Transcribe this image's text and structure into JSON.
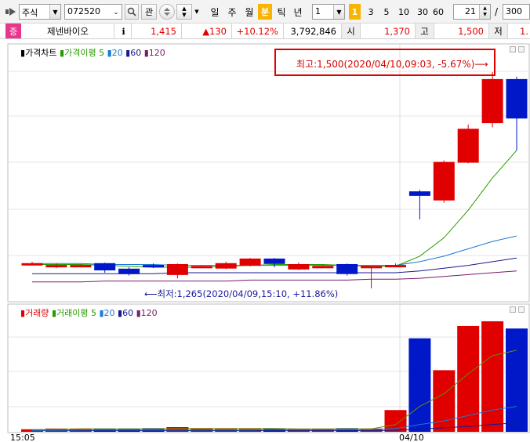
{
  "toolbar": {
    "market_type": "주식",
    "stock_code": "072520",
    "btn_search_glyph": "🔍",
    "btn_watch": "관",
    "periods": [
      "일",
      "주",
      "월",
      "분",
      "틱",
      "년"
    ],
    "active_period": "분",
    "interval_value": "1",
    "interval_marker": "1",
    "quick_intervals": [
      "3",
      "5",
      "10",
      "30",
      "60"
    ],
    "count_value": "21",
    "count_sep": "/",
    "count_total": "300"
  },
  "quote": {
    "badge": "증",
    "name": "제넨바이오",
    "info_btn": "i",
    "price": "1,415",
    "change": "▲130",
    "change_pct": "+10.12%",
    "volume": "3,792,846",
    "open_label": "시",
    "open": "1,370",
    "high_label": "고",
    "high": "1,500",
    "low_label": "저",
    "low_partial": "1."
  },
  "price_legend": {
    "title": "가격차트",
    "ma_label": "가격이평",
    "periods": [
      "5",
      "20",
      "60",
      "120"
    ]
  },
  "volume_legend": {
    "title": "거래량",
    "ma_label": "거래이평",
    "periods": [
      "5",
      "20",
      "60",
      "120"
    ]
  },
  "annotations": {
    "high": "최고:1,500(2020/04/10,09:03, -5.67%)⟶",
    "low": "⟵최저:1,265(2020/04/09,15:10, +11.86%)"
  },
  "x_labels": [
    "15:05",
    "04/10"
  ],
  "colors": {
    "up": "#e00000",
    "down": "#0018c8",
    "ma5": "#2a9a00",
    "ma20": "#1a7ad6",
    "ma60": "#1a1a8a",
    "ma120": "#7a1a6a"
  },
  "chart_data": {
    "type": "candlestick",
    "price_high": 1500,
    "price_low": 1265,
    "candles": [
      {
        "o": 1292,
        "c": 1292,
        "h": 1294,
        "l": 1290
      },
      {
        "o": 1289,
        "c": 1290,
        "h": 1292,
        "l": 1287
      },
      {
        "o": 1290,
        "c": 1290,
        "h": 1291,
        "l": 1288
      },
      {
        "o": 1292,
        "c": 1285,
        "h": 1293,
        "l": 1282
      },
      {
        "o": 1286,
        "c": 1281,
        "h": 1288,
        "l": 1279
      },
      {
        "o": 1290,
        "c": 1289,
        "h": 1292,
        "l": 1287
      },
      {
        "o": 1280,
        "c": 1291,
        "h": 1292,
        "l": 1276
      },
      {
        "o": 1289,
        "c": 1289,
        "h": 1290,
        "l": 1288
      },
      {
        "o": 1287,
        "c": 1292,
        "h": 1294,
        "l": 1286
      },
      {
        "o": 1290,
        "c": 1297,
        "h": 1298,
        "l": 1289
      },
      {
        "o": 1297,
        "c": 1292,
        "h": 1298,
        "l": 1288
      },
      {
        "o": 1286,
        "c": 1291,
        "h": 1293,
        "l": 1285
      },
      {
        "o": 1289,
        "c": 1289,
        "h": 1290,
        "l": 1288
      },
      {
        "o": 1291,
        "c": 1281,
        "h": 1292,
        "l": 1279
      },
      {
        "o": 1289,
        "c": 1289,
        "h": 1290,
        "l": 1265
      },
      {
        "o": 1290,
        "c": 1290,
        "h": 1292,
        "l": 1288
      },
      {
        "o": 1370,
        "c": 1366,
        "h": 1372,
        "l": 1340
      },
      {
        "o": 1361,
        "c": 1402,
        "h": 1404,
        "l": 1358
      },
      {
        "o": 1402,
        "c": 1438,
        "h": 1443,
        "l": 1401
      },
      {
        "o": 1445,
        "c": 1492,
        "h": 1500,
        "l": 1440
      },
      {
        "o": 1492,
        "c": 1450,
        "h": 1495,
        "l": 1415
      }
    ],
    "ma5": [
      1291,
      1291,
      1291,
      1290,
      1289,
      1288,
      1288,
      1288,
      1289,
      1290,
      1291,
      1291,
      1291,
      1290,
      1289,
      1289,
      1300,
      1320,
      1350,
      1385,
      1415
    ],
    "ma20": [
      1292,
      1292,
      1292,
      1291,
      1291,
      1291,
      1290,
      1290,
      1290,
      1290,
      1290,
      1290,
      1290,
      1290,
      1290,
      1290,
      1294,
      1300,
      1308,
      1316,
      1322
    ],
    "ma60": [
      1281,
      1281,
      1281,
      1281,
      1281,
      1281,
      1282,
      1282,
      1282,
      1282,
      1282,
      1282,
      1282,
      1282,
      1282,
      1282,
      1284,
      1287,
      1290,
      1294,
      1298
    ],
    "ma120": [
      1272,
      1272,
      1272,
      1273,
      1273,
      1273,
      1273,
      1273,
      1273,
      1274,
      1274,
      1274,
      1274,
      1274,
      1275,
      1275,
      1276,
      1278,
      1280,
      1282,
      1284
    ],
    "volume": [
      7,
      9,
      9,
      9,
      9,
      10,
      13,
      9,
      8,
      8,
      9,
      7,
      8,
      10,
      9,
      60,
      258,
      170,
      292,
      305,
      285
    ],
    "vol_ma5": [
      6,
      7,
      8,
      8,
      8,
      8,
      9,
      9,
      9,
      9,
      9,
      8,
      8,
      8,
      8,
      20,
      70,
      105,
      160,
      210,
      225
    ],
    "vol_ma20": [
      4,
      4,
      5,
      5,
      5,
      5,
      5,
      5,
      5,
      5,
      6,
      6,
      6,
      6,
      6,
      9,
      20,
      30,
      45,
      60,
      70
    ],
    "vol_ma60": [
      3,
      3,
      3,
      3,
      3,
      3,
      3,
      3,
      3,
      3,
      3,
      3,
      3,
      3,
      3,
      4,
      8,
      11,
      15,
      20,
      25
    ],
    "vol_max": 320
  }
}
